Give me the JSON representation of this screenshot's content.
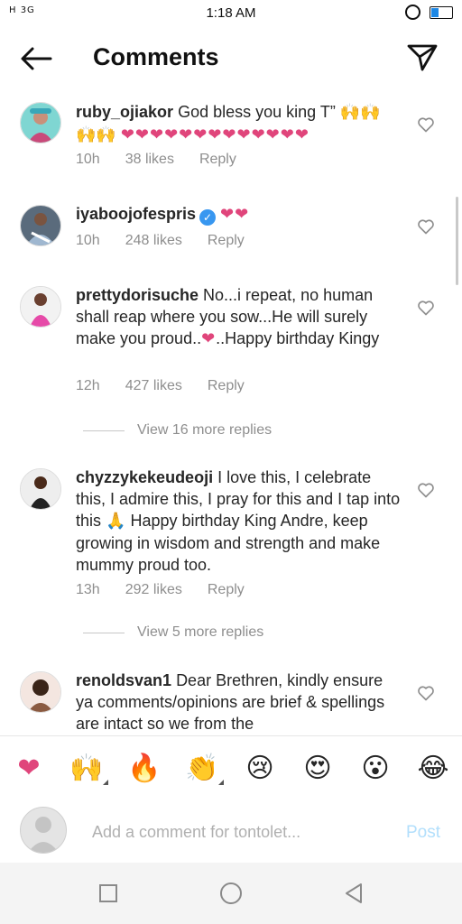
{
  "status_bar": {
    "network": "H 3G",
    "time": "1:18 AM",
    "battery_level": 0.35
  },
  "header": {
    "title": "Comments",
    "back_icon": "arrow-left-icon",
    "send_icon": "paper-plane-icon"
  },
  "comments": [
    {
      "username": "ruby_ojiakor",
      "text": "God bless you king T”",
      "emoji_after": "🙌🙌",
      "emoji_line2": "🙌🙌",
      "hearts": "❤❤❤❤❤❤❤❤❤❤❤❤❤",
      "time": "10h",
      "likes": "38 likes",
      "reply": "Reply"
    },
    {
      "username": "iyaboojofespris",
      "verified": true,
      "hearts": "❤❤",
      "time": "10h",
      "likes": "248 likes",
      "reply": "Reply"
    },
    {
      "username": "prettydorisuche",
      "text": "No...i repeat, no  human shall reap where you sow...He will surely make you proud..",
      "heart": "❤",
      "text_end": "..Happy birthday Kingy",
      "time": "12h",
      "likes": "427 likes",
      "reply": "Reply",
      "view_replies": "View 16 more replies"
    },
    {
      "username": "chyzzykekeudeoji",
      "text": "I love this, I celebrate this, I admire this, I pray for this and I tap into this",
      "emoji": "🙏",
      "text_end": "Happy birthday King Andre, keep growing in wisdom and strength and make mummy proud too.",
      "time": "13h",
      "likes": "292 likes",
      "reply": "Reply",
      "view_replies": "View 5 more replies"
    },
    {
      "username": "renoldsvan1",
      "text": "Dear Brethren, kindly ensure ya comments/opinions are brief & spellings are intact so we from the"
    }
  ],
  "quick_emojis": [
    "❤",
    "🙌",
    "🔥",
    "👏",
    "😢",
    "😍",
    "😮",
    "😂"
  ],
  "comment_box": {
    "placeholder": "Add a comment for tontolet...",
    "post_label": "Post"
  },
  "colors": {
    "heart": "#e0457b",
    "verified": "#3897f0",
    "post_disabled": "#b2dffc",
    "meta_gray": "#8e8e8e"
  }
}
